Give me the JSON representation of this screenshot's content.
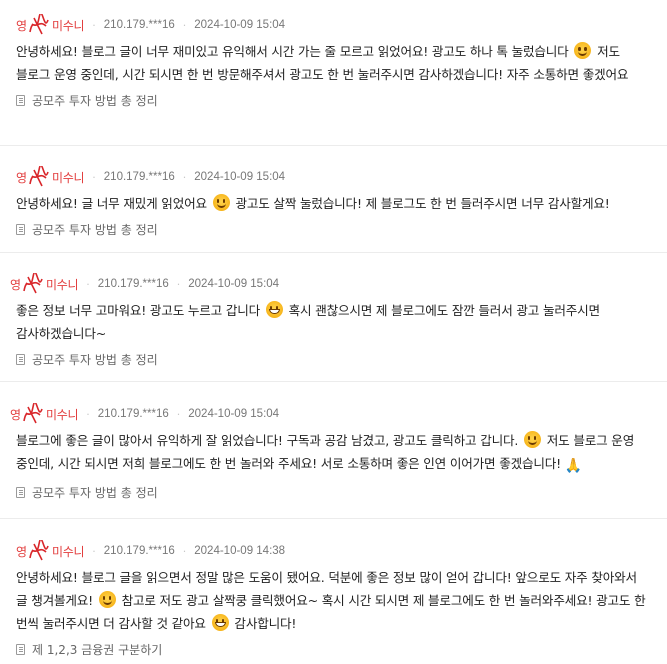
{
  "comments": [
    {
      "prefix": "영",
      "nickname": "미수니",
      "ip": "210.179.***16",
      "date": "2024-10-09 15:04",
      "text_parts": [
        "안녕하세요! 블로그 글이 너무 재미있고 유익해서 시간 가는 줄 모르고 읽었어요! 광고도 하나 톡 눌렀습니다 ",
        " 저도 블로그 운영 중인데, 시간 되시면 한 번 방문해주셔서 광고도 한 번 눌러주시면 감사하겠습니다! 자주 소통하면 좋겠어요"
      ],
      "emoji": [
        "smile-emoji"
      ],
      "ref_title": "공모주 투자 방법 총 정리"
    },
    {
      "prefix": "영",
      "nickname": "미수니",
      "ip": "210.179.***16",
      "date": "2024-10-09 15:04",
      "text_parts": [
        "안녕하세요! 글 너무 재밌게 읽었어요 ",
        " 광고도 살짝 눌렀습니다! 제 블로그도 한 번 들러주시면 너무 감사할게요!"
      ],
      "emoji": [
        "smile-emoji"
      ],
      "ref_title": "공모주 투자 방법 총 정리"
    },
    {
      "prefix": "영",
      "nickname": "미수니",
      "ip": "210.179.***16",
      "date": "2024-10-09 15:04",
      "text_parts": [
        "좋은 정보 너무 고마워요! 광고도 누르고 갑니다 ",
        " 혹시 괜찮으시면 제 블로그에도 잠깐 들러서 광고 눌러주시면 감사하겠습니다~"
      ],
      "emoji": [
        "grin-emoji"
      ],
      "ref_title": "공모주 투자 방법 총 정리"
    },
    {
      "prefix": "영",
      "nickname": "미수니",
      "ip": "210.179.***16",
      "date": "2024-10-09 15:04",
      "text_parts": [
        "블로그에 좋은 글이 많아서 유익하게 잘 읽었습니다! 구독과 공감 남겼고, 광고도 클릭하고 갑니다. ",
        " 저도 블로그 운영 중인데, 시간 되시면 저희 블로그에도 한 번 놀러와 주세요! 서로 소통하며 좋은 인연 이어가면 좋겠습니다! "
      ],
      "emoji": [
        "smile-emoji",
        "folded-hands-emoji"
      ],
      "ref_title": "공모주 투자 방법 총 정리"
    },
    {
      "prefix": "영",
      "nickname": "미수니",
      "ip": "210.179.***16",
      "date": "2024-10-09 14:38",
      "text_parts": [
        "안녕하세요! 블로그 글을 읽으면서 정말 많은 도움이 됐어요. 덕분에 좋은 정보 많이 얻어 갑니다! 앞으로도 자주 찾아와서 글 챙겨볼게요! ",
        " 참고로 저도 광고 살짝쿵 클릭했어요~ 혹시 시간 되시면 제 블로그에도 한 번 놀러와주세요! 광고도 한 번씩 눌러주시면 더 감사할 것 같아요 ",
        " 감사합니다!"
      ],
      "emoji": [
        "smile-emoji",
        "grin-emoji"
      ],
      "ref_title": "제 1,2,3 금융권 구분하기"
    }
  ],
  "colors": {
    "nickname": "#e23b3b",
    "meta": "#777777",
    "divider": "#ececec"
  }
}
